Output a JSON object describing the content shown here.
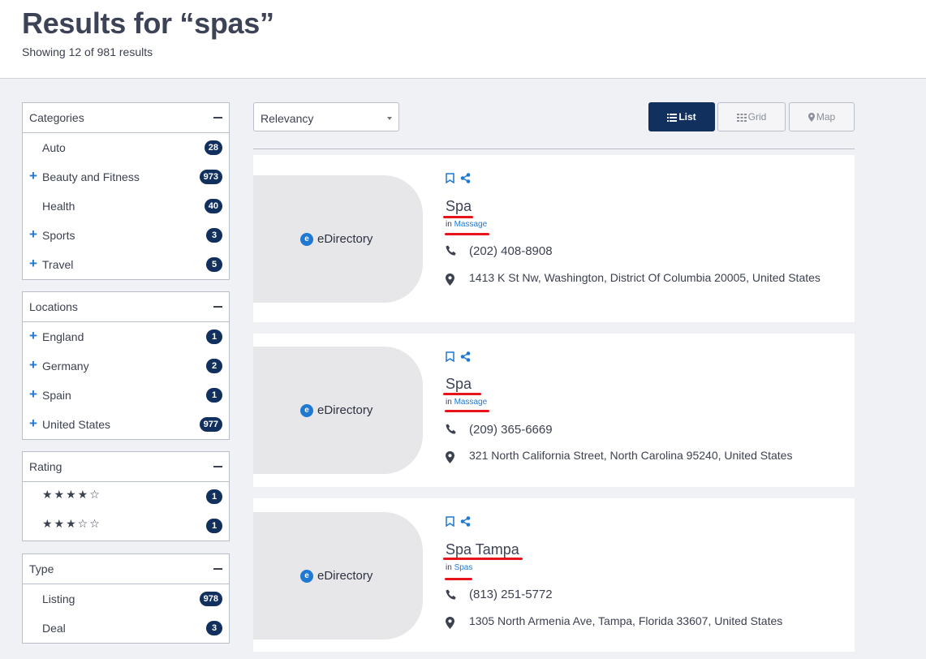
{
  "header": {
    "title": "Results for “spas”",
    "subtitle": "Showing 12 of 981 results"
  },
  "filters": {
    "categories": {
      "title": "Categories",
      "items": [
        {
          "label": "Auto",
          "count": "28",
          "expandable": false
        },
        {
          "label": "Beauty and Fitness",
          "count": "973",
          "expandable": true
        },
        {
          "label": "Health",
          "count": "40",
          "expandable": false
        },
        {
          "label": "Sports",
          "count": "3",
          "expandable": true
        },
        {
          "label": "Travel",
          "count": "5",
          "expandable": true
        }
      ]
    },
    "locations": {
      "title": "Locations",
      "items": [
        {
          "label": "England",
          "count": "1",
          "expandable": true
        },
        {
          "label": "Germany",
          "count": "2",
          "expandable": true
        },
        {
          "label": "Spain",
          "count": "1",
          "expandable": true
        },
        {
          "label": "United States",
          "count": "977",
          "expandable": true
        }
      ]
    },
    "rating": {
      "title": "Rating",
      "items": [
        {
          "stars": 4,
          "count": "1"
        },
        {
          "stars": 3,
          "count": "1"
        }
      ]
    },
    "type": {
      "title": "Type",
      "items": [
        {
          "label": "Listing",
          "count": "978",
          "expandable": false
        },
        {
          "label": "Deal",
          "count": "3",
          "expandable": false
        }
      ]
    }
  },
  "toolbar": {
    "sort": "Relevancy",
    "views": {
      "list": "List",
      "grid": "Grid",
      "map": "Map"
    }
  },
  "results": [
    {
      "title": "Spa",
      "in": "in",
      "category": "Massage",
      "logo": "eDirectory",
      "phone": "(202) 408-8908",
      "address": "1413 K St Nw, Washington, District Of Columbia 20005, United States"
    },
    {
      "title": "Spa",
      "in": "in",
      "category": "Massage",
      "logo": "eDirectory",
      "phone": "(209) 365-6669",
      "address": "321 North California Street, North Carolina 95240, United States"
    },
    {
      "title": "Spa Tampa",
      "in": "in",
      "category": "Spas",
      "logo": "eDirectory",
      "phone": "(813) 251-5772",
      "address": "1305 North Armenia Ave, Tampa, Florida 33607, United States"
    }
  ],
  "colors": {
    "accent": "#1f78d1",
    "badge": "#12305d",
    "annotation": "#e8141b"
  }
}
